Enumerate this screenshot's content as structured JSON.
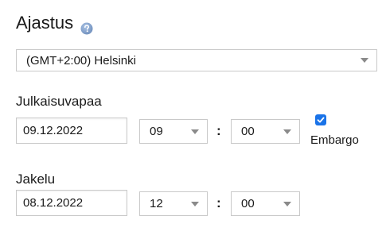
{
  "header": {
    "title": "Ajastus",
    "help_icon": "question-circle-icon"
  },
  "timezone": {
    "selected": "(GMT+2:00) Helsinki"
  },
  "publish": {
    "label": "Julkaisuvapaa",
    "date": "09.12.2022",
    "hour": "09",
    "minute": "00",
    "separator": ":",
    "embargo_checked": true,
    "embargo_label": "Embargo"
  },
  "distribution": {
    "label": "Jakelu",
    "date": "08.12.2022",
    "hour": "12",
    "minute": "00",
    "separator": ":"
  },
  "colors": {
    "accent": "#1a73e8",
    "help_icon": "#7f9fc8",
    "border": "#c9c9c9",
    "caret": "#8a8a8a"
  }
}
